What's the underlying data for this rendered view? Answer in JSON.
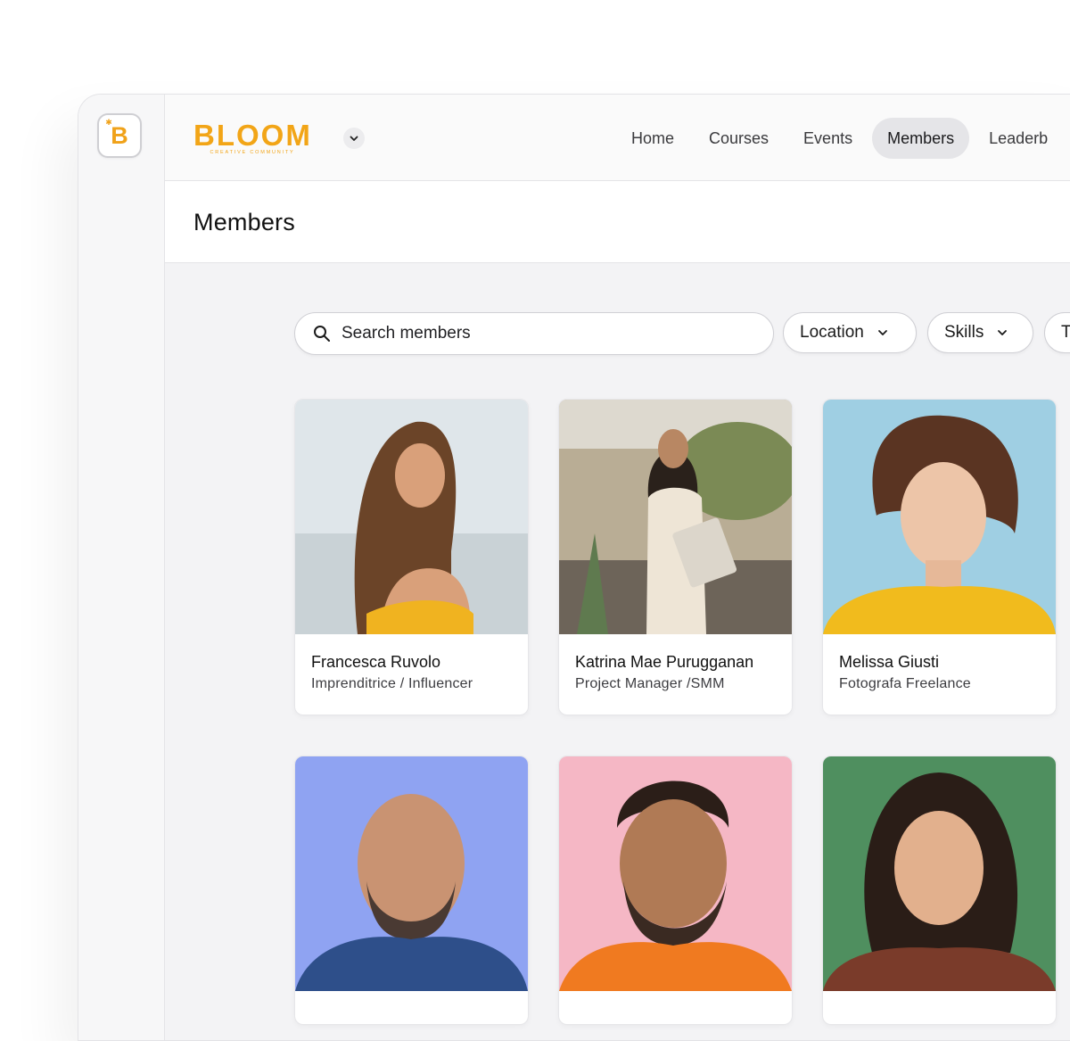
{
  "rail": {
    "logo_letter": "B"
  },
  "brand": {
    "name": "BLOOM",
    "tagline": "CREATIVE COMMUNITY"
  },
  "nav": {
    "items": [
      {
        "label": "Home",
        "active": false
      },
      {
        "label": "Courses",
        "active": false
      },
      {
        "label": "Events",
        "active": false
      },
      {
        "label": "Members",
        "active": true
      },
      {
        "label": "Leaderb",
        "active": false
      }
    ]
  },
  "page": {
    "title": "Members"
  },
  "search": {
    "placeholder": "Search members",
    "value": ""
  },
  "filters": [
    {
      "label": "Location"
    },
    {
      "label": "Skills"
    },
    {
      "label": "T"
    }
  ],
  "members": [
    {
      "name": "Francesca Ruvolo",
      "role": "Imprenditrice / Influencer",
      "photo_bg": "#dfe6ea"
    },
    {
      "name": "Katrina Mae Purugganan",
      "role": "Project Manager /SMM",
      "photo_bg": "#b9ad95"
    },
    {
      "name": "Melissa Giusti",
      "role": "Fotografa Freelance",
      "photo_bg": "#9fcfe3"
    },
    {
      "name": "",
      "role": "",
      "photo_bg": "#8fa3f2"
    },
    {
      "name": "",
      "role": "",
      "photo_bg": "#f5b7c5"
    },
    {
      "name": "",
      "role": "",
      "photo_bg": "#4f8f5f"
    }
  ],
  "colors": {
    "brand_accent": "#f2a517",
    "active_nav_bg": "#e5e5e8",
    "page_bg": "#f3f3f5"
  }
}
